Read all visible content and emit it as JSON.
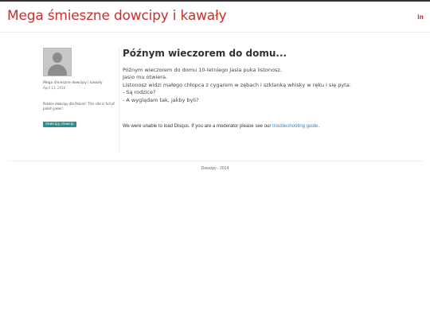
{
  "header": {
    "site_title": "Mega śmieszne dowcipy i kawały",
    "linkedin_label": "in",
    "accent_color": "#c9302c"
  },
  "sidebar": {
    "author": "Mega śmieszne dowcipy i kawały",
    "date": "April 13, 2016",
    "description": "Polskie dowcipy dla Polonii! This site is full of polish jokes!",
    "tag": "dowcipy,dowcip",
    "tag_color": "#2e8b8b"
  },
  "post": {
    "title": "Późnym wieczorem do domu...",
    "lines": [
      "Późnym wieczorem do domu 10-letniego Jasia puka listonosz.",
      "Jasio mu otwiera.",
      "Listonosz widzi małego chłopca z cygarem w zębach i szklanką whisky w ręku i się pyta:",
      "- Są rodzice?",
      "- A wyglądam tak, jakby byli?"
    ]
  },
  "disqus": {
    "message": "We were unable to load Disqus. If you are a moderator please see our ",
    "link_text": "troubleshooting guide",
    "suffix": "."
  },
  "footer": {
    "text": "Dowcipy - 2014"
  }
}
